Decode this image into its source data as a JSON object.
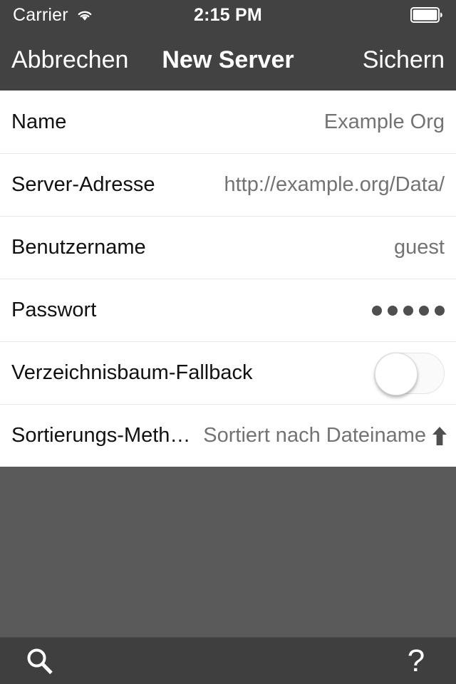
{
  "status_bar": {
    "carrier": "Carrier",
    "wifi_icon": "wifi-icon",
    "time": "2:15 PM",
    "battery_icon": "battery-full-icon"
  },
  "nav_bar": {
    "cancel_label": "Abbrechen",
    "title": "New Server",
    "save_label": "Sichern"
  },
  "form": {
    "rows": [
      {
        "label": "Name",
        "value": "Example Org"
      },
      {
        "label": "Server-Adresse",
        "value": "http://example.org/Data/"
      },
      {
        "label": "Benutzername",
        "value": "guest"
      },
      {
        "label": "Passwort",
        "value": "●●●●●",
        "masked_dots": 5
      },
      {
        "label": "Verzeichnisbaum-Fallback",
        "value": "off",
        "control": "toggle"
      },
      {
        "label": "Sortierungs-Meth…",
        "value": "Sortiert nach Dateiname",
        "direction_icon": "arrow-up-icon"
      }
    ]
  },
  "toolbar": {
    "search_icon": "search-icon",
    "help_label": "?"
  },
  "colors": {
    "nav_background": "#424242",
    "toolbar_background": "#3f3f3f",
    "empty_background": "#5a5a5a",
    "row_background": "#ffffff",
    "label_text": "#111111",
    "value_text": "#737373",
    "nav_text": "#ffffff"
  }
}
